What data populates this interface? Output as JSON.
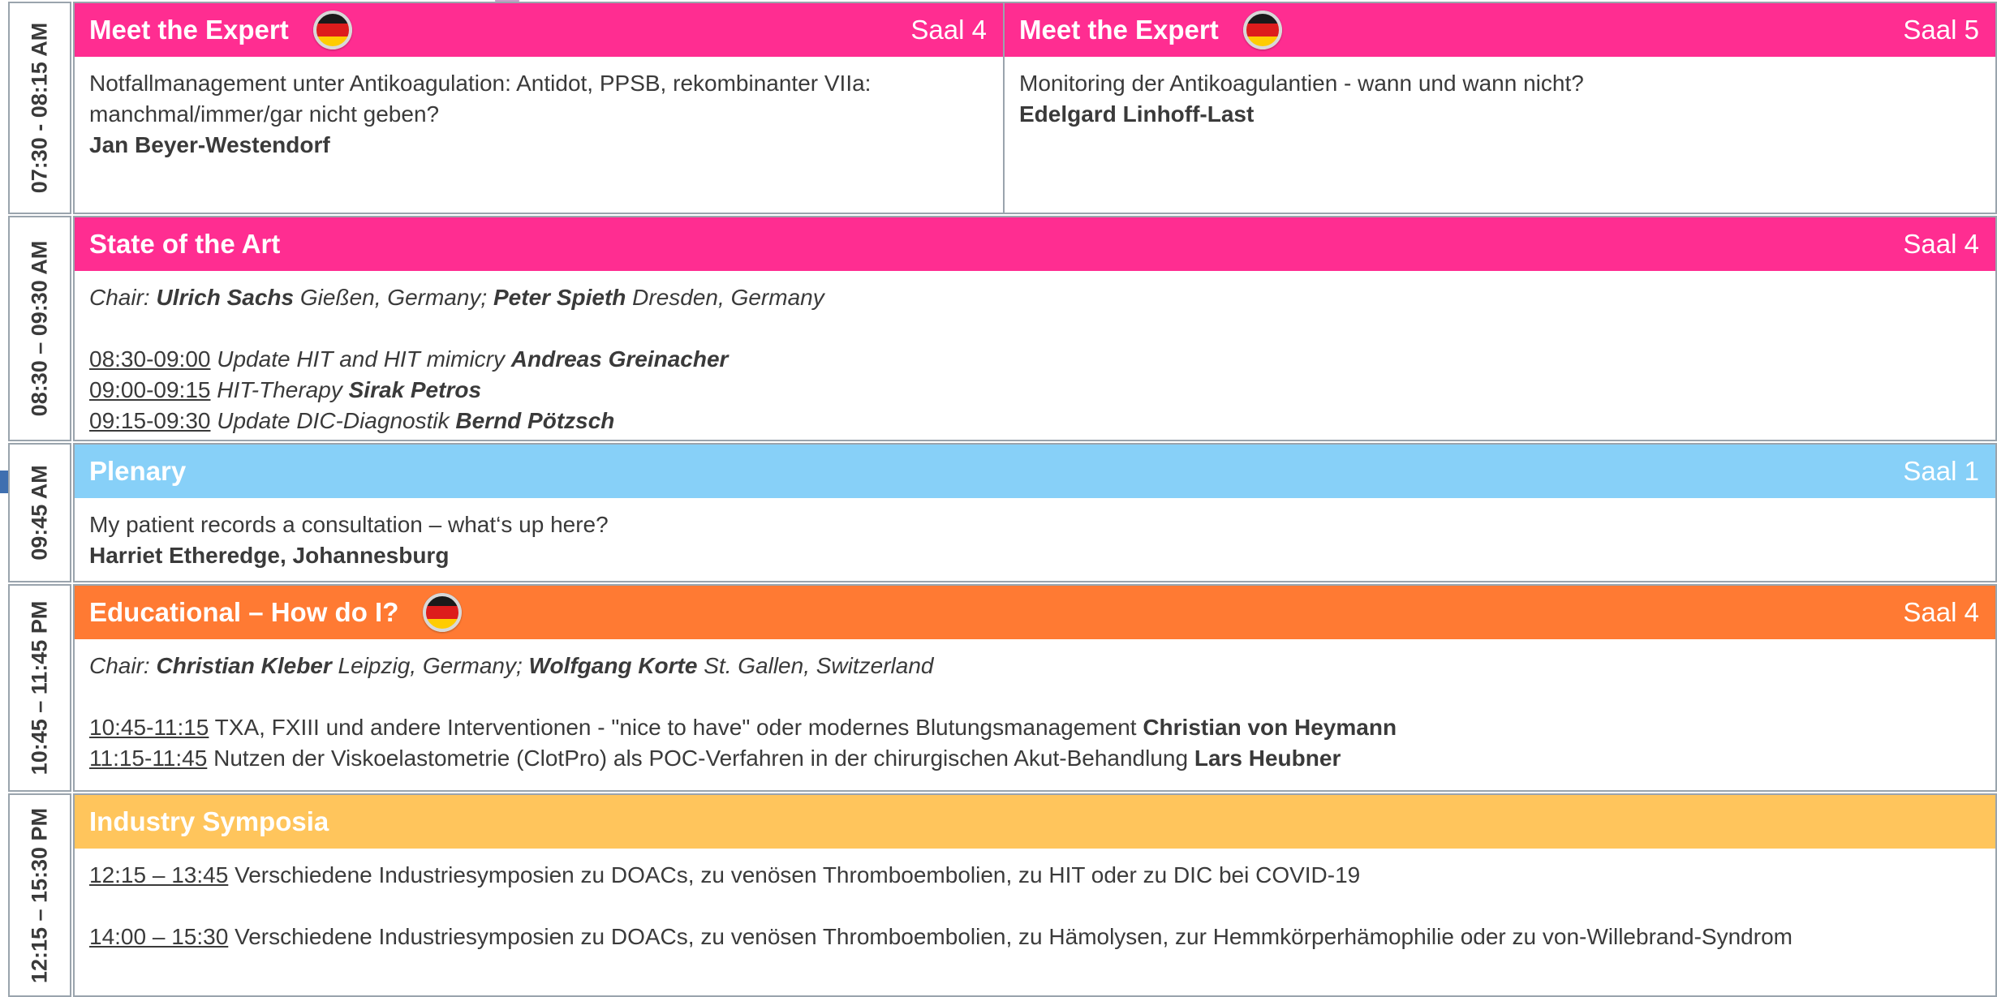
{
  "colors": {
    "magenta": "#ff2d91",
    "lightblue": "#87d0f8",
    "orange": "#ff7a33",
    "yellow": "#ffc55c"
  },
  "slots": [
    {
      "time": "07:30 - 08:15 AM"
    },
    {
      "time": "08:30 – 09:30 AM"
    },
    {
      "time": "09:45 AM"
    },
    {
      "time": "10:45 – 11:45 PM"
    },
    {
      "time": "12:15 – 15:30 PM"
    }
  ],
  "meet1": {
    "title": "Meet the Expert",
    "flag": "german-flag-icon",
    "room": "Saal 4",
    "topic": "Notfallmanagement unter Antikoagulation: Antidot, PPSB, rekombinanter VIIa: manchmal/immer/gar nicht geben?",
    "speaker": "Jan Beyer-Westendorf"
  },
  "meet2": {
    "title": "Meet the Expert",
    "flag": "german-flag-icon",
    "room": "Saal 5",
    "topic": "Monitoring der Antikoagulantien - wann und wann nicht?",
    "speaker": "Edelgard Linhoff-Last"
  },
  "state": {
    "title": "State of the Art",
    "room": "Saal 4",
    "chair_label": "Chair:",
    "chair1_name": "Ulrich Sachs",
    "chair1_place": "Gießen, Germany;",
    "chair2_name": "Peter Spieth",
    "chair2_place": "Dresden, Germany",
    "talks": [
      {
        "time": "08:30-09:00",
        "title": "Update HIT and HIT mimicry",
        "speaker": "Andreas Greinacher"
      },
      {
        "time": "09:00-09:15",
        "title": "HIT-Therapy",
        "speaker": "Sirak Petros"
      },
      {
        "time": "09:15-09:30",
        "title": "Update DIC-Diagnostik",
        "speaker": "Bernd Pötzsch"
      }
    ]
  },
  "plenary": {
    "title": "Plenary",
    "room": "Saal 1",
    "topic": "My patient records a consultation – what‘s up here?",
    "speaker": "Harriet Etheredge, Johannesburg"
  },
  "educational": {
    "title": "Educational – How do I?",
    "flag": "german-flag-icon",
    "room": "Saal 4",
    "chair_label": "Chair:",
    "chair1_name": "Christian Kleber",
    "chair1_place": "Leipzig, Germany;",
    "chair2_name": "Wolfgang Korte",
    "chair2_place": "St. Gallen, Switzerland",
    "talks": [
      {
        "time": "10:45-11:15",
        "title": "TXA, FXIII und andere Interventionen - \"nice to have\" oder modernes Blutungsmanagement",
        "speaker": "Christian von Heymann"
      },
      {
        "time": "11:15-11:45",
        "title": "Nutzen der Viskoelastometrie (ClotPro) als POC-Verfahren in der chirurgischen Akut-Behandlung",
        "speaker": "Lars Heubner"
      }
    ]
  },
  "industry": {
    "title": "Industry Symposia",
    "items": [
      {
        "time": "12:15 – 13:45",
        "text": "Verschiedene Industriesymposien zu DOACs, zu venösen Thromboembolien,  zu HIT oder zu DIC bei COVID-19"
      },
      {
        "time": "14:00 – 15:30",
        "text": "Verschiedene Industriesymposien zu DOACs, zu venösen Thromboembolien,  zu Hämolysen, zur Hemmkörperhämophilie  oder zu von-Willebrand-Syndrom"
      }
    ]
  }
}
